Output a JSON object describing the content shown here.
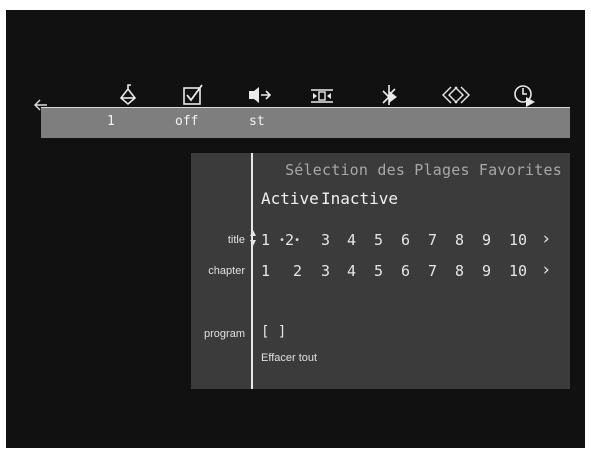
{
  "toolbar": {
    "icons": [
      "audio-icon",
      "subtitle-check-icon",
      "angle-speaker-icon",
      "zoom-frame-icon",
      "camera-angle-icon",
      "fast-forward-icon",
      "timer-play-icon"
    ]
  },
  "status": {
    "values": [
      "1",
      "off",
      "st"
    ]
  },
  "panel": {
    "title": "Sélection des Plages Favorites",
    "mode_active": "Active",
    "mode_inactive": "Inactive",
    "title_row": {
      "label": "title",
      "numbers": [
        "1",
        "2",
        "3",
        "4",
        "5",
        "6",
        "7",
        "8",
        "9",
        "10"
      ],
      "more": "›"
    },
    "chapter_row": {
      "label": "chapter",
      "numbers": [
        "1",
        "2",
        "3",
        "4",
        "5",
        "6",
        "7",
        "8",
        "9",
        "10"
      ],
      "more": "›"
    },
    "program": {
      "label": "program",
      "value": "[ ]"
    },
    "clear_all": "Effacer tout"
  },
  "colors": {
    "screen_bg": "#111111",
    "status_bar": "#7e7e7e",
    "panel_bg": "#3b3b3b",
    "text": "#e6e6e6"
  }
}
